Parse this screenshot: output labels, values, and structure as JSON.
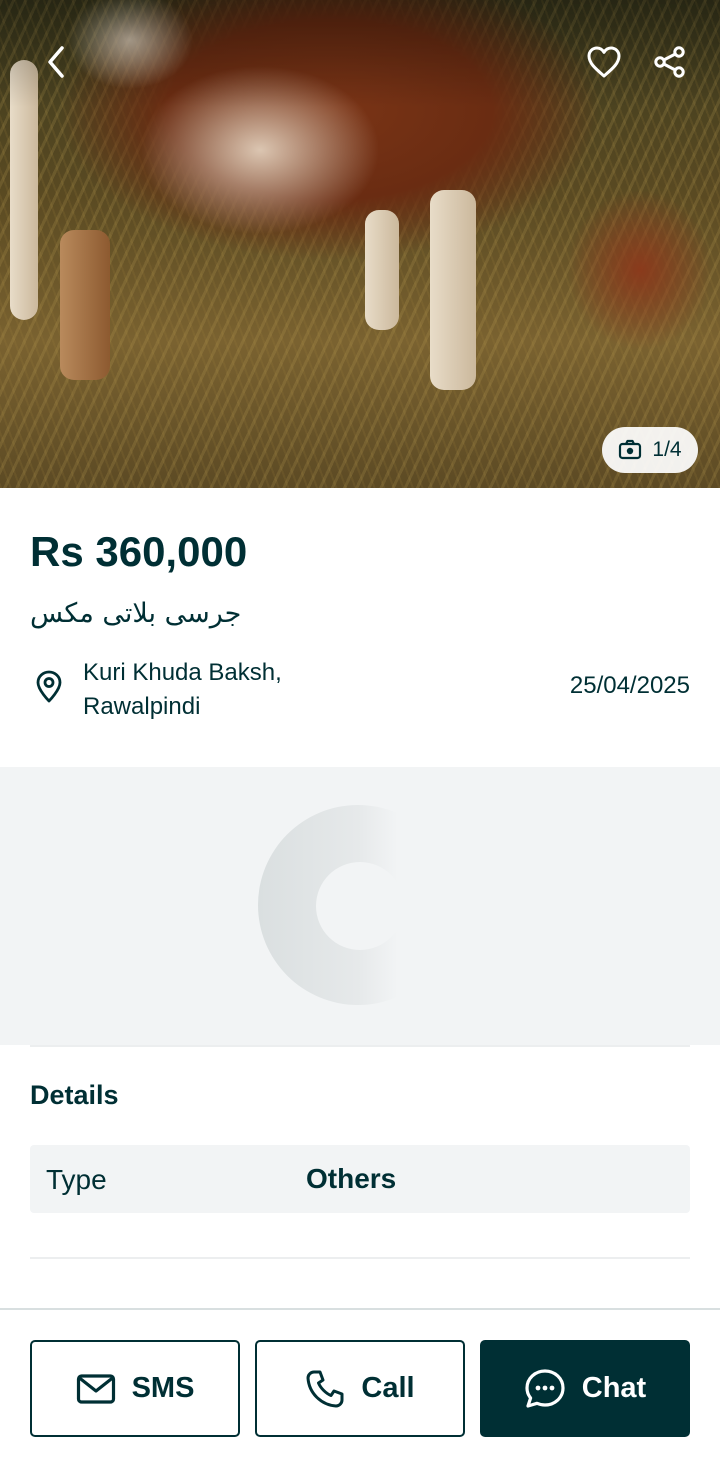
{
  "hero": {
    "image_subject": "cow-photo",
    "counter_text": "1/4"
  },
  "listing": {
    "price": "Rs 360,000",
    "title": "جرسی بلاتی مکس",
    "location": "Kuri Khuda Baksh, Rawalpindi",
    "date": "25/04/2025"
  },
  "details": {
    "heading": "Details",
    "rows": [
      {
        "key": "Type",
        "value": "Others"
      }
    ]
  },
  "actions": {
    "sms_label": "SMS",
    "call_label": "Call",
    "chat_label": "Chat"
  },
  "icons": {
    "back": "chevron-left-icon",
    "favorite": "heart-icon",
    "share": "share-icon",
    "camera": "camera-icon",
    "location": "location-pin-icon",
    "sms": "mail-icon",
    "call": "phone-icon",
    "chat": "chat-bubble-icon"
  },
  "colors": {
    "primary": "#002f34",
    "surface": "#f2f4f5",
    "white": "#ffffff"
  }
}
